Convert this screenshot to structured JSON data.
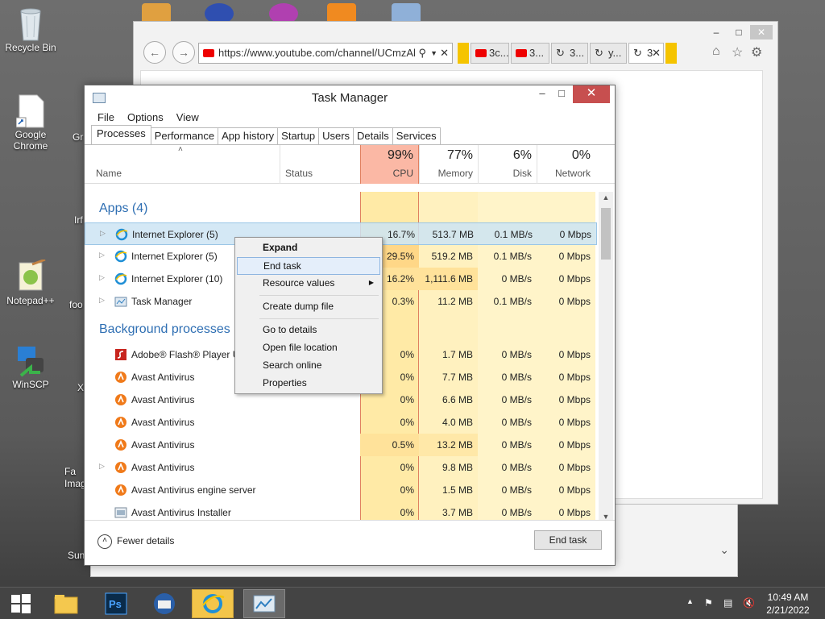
{
  "desktop": {
    "icons": [
      {
        "label": "Recycle Bin"
      },
      {
        "label": "Google Chrome"
      },
      {
        "label": "Notepad++"
      },
      {
        "label": "WinSCP"
      }
    ],
    "partial_labels": [
      "Gr",
      "Irf",
      "foo",
      "X",
      "Fa Imag",
      "Sun"
    ]
  },
  "browser": {
    "address": "https://www.youtube.com/channel/UCmzAl",
    "tabs": [
      {
        "label": "3c..."
      },
      {
        "label": "3..."
      },
      {
        "label": "3..."
      },
      {
        "label": "y..."
      },
      {
        "label": "3"
      }
    ]
  },
  "task_manager": {
    "title": "Task Manager",
    "menu": [
      "File",
      "Options",
      "View"
    ],
    "tabs": [
      "Processes",
      "Performance",
      "App history",
      "Startup",
      "Users",
      "Details",
      "Services"
    ],
    "columns": {
      "name": "Name",
      "status": "Status",
      "cpu_pct": "99%",
      "cpu": "CPU",
      "memory_pct": "77%",
      "memory": "Memory",
      "disk_pct": "6%",
      "disk": "Disk",
      "network_pct": "0%",
      "network": "Network"
    },
    "apps_header": "Apps (4)",
    "bg_header": "Background processes (4",
    "apps": [
      {
        "name": "Internet Explorer (5)",
        "cpu": "16.7%",
        "memory": "513.7 MB",
        "disk": "0.1 MB/s",
        "network": "0 Mbps"
      },
      {
        "name": "Internet Explorer (5)",
        "cpu": "29.5%",
        "memory": "519.2 MB",
        "disk": "0.1 MB/s",
        "network": "0 Mbps"
      },
      {
        "name": "Internet Explorer (10)",
        "cpu": "16.2%",
        "memory": "1,111.6 MB",
        "disk": "0 MB/s",
        "network": "0 Mbps"
      },
      {
        "name": "Task Manager",
        "cpu": "0.3%",
        "memory": "11.2 MB",
        "disk": "0.1 MB/s",
        "network": "0 Mbps"
      }
    ],
    "background": [
      {
        "name": "Adobe® Flash® Player U",
        "cpu": "0%",
        "memory": "1.7 MB",
        "disk": "0 MB/s",
        "network": "0 Mbps"
      },
      {
        "name": "Avast Antivirus",
        "cpu": "0%",
        "memory": "7.7 MB",
        "disk": "0 MB/s",
        "network": "0 Mbps"
      },
      {
        "name": "Avast Antivirus",
        "cpu": "0%",
        "memory": "6.6 MB",
        "disk": "0 MB/s",
        "network": "0 Mbps"
      },
      {
        "name": "Avast Antivirus",
        "cpu": "0%",
        "memory": "4.0 MB",
        "disk": "0 MB/s",
        "network": "0 Mbps"
      },
      {
        "name": "Avast Antivirus",
        "cpu": "0.5%",
        "memory": "13.2 MB",
        "disk": "0 MB/s",
        "network": "0 Mbps"
      },
      {
        "name": "Avast Antivirus",
        "cpu": "0%",
        "memory": "9.8 MB",
        "disk": "0 MB/s",
        "network": "0 Mbps"
      },
      {
        "name": "Avast Antivirus engine server",
        "cpu": "0%",
        "memory": "1.5 MB",
        "disk": "0 MB/s",
        "network": "0 Mbps"
      },
      {
        "name": "Avast Antivirus Installer",
        "cpu": "0%",
        "memory": "3.7 MB",
        "disk": "0 MB/s",
        "network": "0 Mbps"
      }
    ],
    "fewer_details": "Fewer details",
    "end_task_button": "End task"
  },
  "context_menu": {
    "items": [
      "Expand",
      "End task",
      "Resource values",
      "Create dump file",
      "Go to details",
      "Open file location",
      "Search online",
      "Properties"
    ],
    "highlighted": "End task"
  },
  "taskbar": {
    "time": "10:49 AM",
    "date": "2/21/2022"
  },
  "colors": {
    "cpu_header": "#fbb8a5",
    "heat_light": "#fff4c4",
    "heat_medium": "#ffe9a0",
    "heat_strong": "#ffd787",
    "section_blue": "#2f6fb3",
    "taskbar_active": "#f3c54a"
  }
}
